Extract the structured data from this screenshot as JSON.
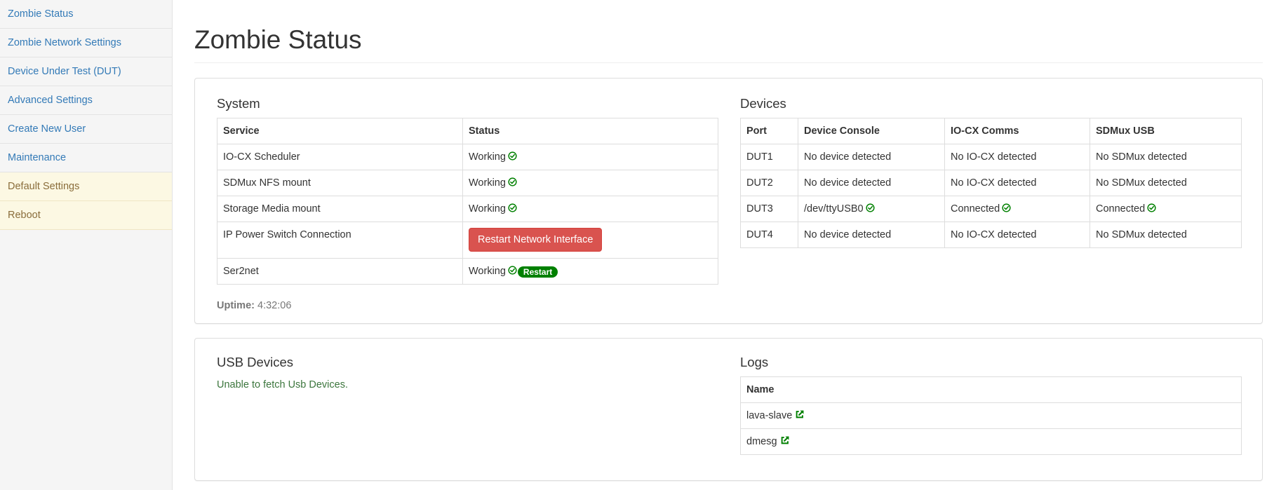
{
  "sidebar": {
    "items": [
      {
        "label": "Zombie Status"
      },
      {
        "label": "Zombie Network Settings"
      },
      {
        "label": "Device Under Test (DUT)"
      },
      {
        "label": "Advanced Settings"
      },
      {
        "label": "Create New User"
      },
      {
        "label": "Maintenance"
      },
      {
        "label": "Default Settings"
      },
      {
        "label": "Reboot"
      }
    ]
  },
  "page": {
    "title": "Zombie Status"
  },
  "system": {
    "title": "System",
    "headers": [
      "Service",
      "Status"
    ],
    "rows": [
      {
        "service": "IO-CX Scheduler",
        "status": "Working"
      },
      {
        "service": "SDMux NFS mount",
        "status": "Working"
      },
      {
        "service": "Storage Media mount",
        "status": "Working"
      },
      {
        "service": "IP Power Switch Connection",
        "button": "Restart Network Interface"
      },
      {
        "service": "Ser2net",
        "status": "Working",
        "badge": "Restart"
      }
    ],
    "uptime_label": "Uptime:",
    "uptime_value": "4:32:06"
  },
  "devices": {
    "title": "Devices",
    "headers": [
      "Port",
      "Device Console",
      "IO-CX Comms",
      "SDMux USB"
    ],
    "rows": [
      [
        "DUT1",
        "No device detected",
        "No IO-CX detected",
        "No SDMux detected"
      ],
      [
        "DUT2",
        "No device detected",
        "No IO-CX detected",
        "No SDMux detected"
      ],
      [
        "DUT3",
        "/dev/ttyUSB0",
        "Connected",
        "Connected"
      ],
      [
        "DUT4",
        "No device detected",
        "No IO-CX detected",
        "No SDMux detected"
      ]
    ]
  },
  "usb": {
    "title": "USB Devices",
    "message": "Unable to fetch Usb Devices."
  },
  "logs": {
    "title": "Logs",
    "header": "Name",
    "items": [
      {
        "name": "lava-slave"
      },
      {
        "name": "dmesg"
      }
    ]
  },
  "colors": {
    "link": "#337ab7",
    "warning_bg": "#fcf8e3",
    "warning_text": "#8a6d3b",
    "success": "#008000",
    "danger": "#d9534f",
    "success_text": "#3c763d"
  },
  "icons": {
    "ok": "check-circle-icon",
    "external": "external-link-icon"
  }
}
